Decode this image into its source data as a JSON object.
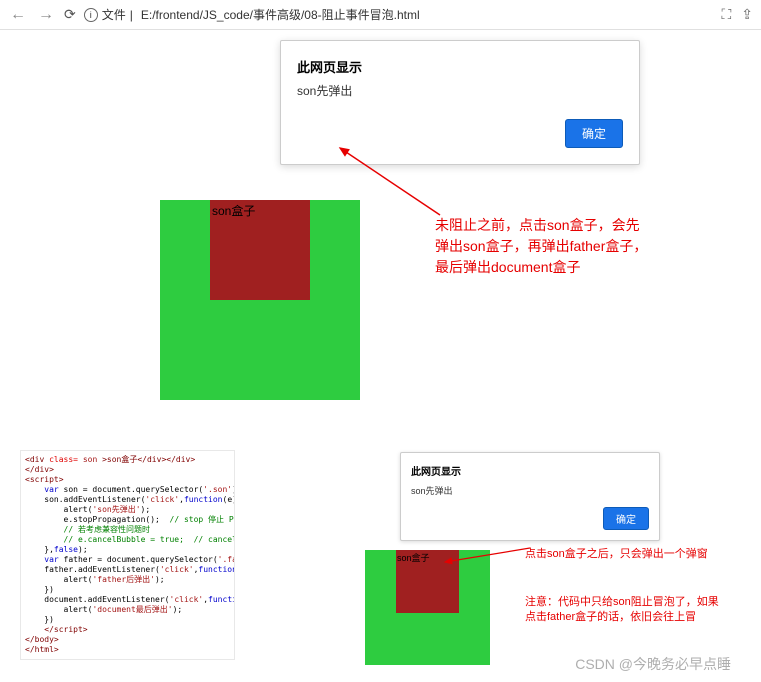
{
  "browser": {
    "file_label": "文件",
    "url": "E:/frontend/JS_code/事件高级/08-阻止事件冒泡.html"
  },
  "dialog": {
    "title": "此网页显示",
    "msg": "son先弹出",
    "ok": "确定"
  },
  "demo": {
    "son_label": "son盒子"
  },
  "notes": {
    "n1a": "未阻止之前，点击son盒子，会先",
    "n1b": "弹出son盒子，再弹出father盒子，",
    "n1c": "最后弹出document盒子",
    "n2": "点击son盒子之后，只会弹出一个弹窗",
    "n3a": "注意：代码中只给son阻止冒泡了，如果",
    "n3b": "点击father盒子的话，依旧会往上冒"
  },
  "code": {
    "l1a": "<div ",
    "l1b": "class=",
    "l1c": " son ",
    "l1d": ">son盒子</div></div>",
    "l2": "</div>",
    "l3": "<script>",
    "l4a": "    var",
    "l4b": " son = document.querySelector(",
    "l4c": "'.son'",
    "l4d": ");",
    "l5a": "    son.addEventListener(",
    "l5b": "'click'",
    "l5c": ",",
    "l5d": "function",
    "l5e": "(e) {",
    "l6a": "        alert(",
    "l6b": "'son先弹出'",
    "l6c": ");",
    "l7a": "        e.stopPropagation();  ",
    "l7b": "// stop 停止 Prop",
    "l8": "        // 若考虑兼容性问题时",
    "l9": "        // e.cancelBubble = true;  // cancel 取",
    "l10a": "    },",
    "l10b": "false",
    "l10c": ");",
    "l11a": "    var",
    "l11b": " father = document.querySelector(",
    "l11c": "'.fathe",
    "l12a": "    father.addEventListener(",
    "l12b": "'click'",
    "l12c": ",",
    "l12d": "function",
    "l12e": "()",
    "l13a": "        alert(",
    "l13b": "'father后弹出'",
    "l13c": ");",
    "l14": "    })",
    "l15a": "    document.addEventListener(",
    "l15b": "'click'",
    "l15c": ",",
    "l15d": "function",
    "l15e": "()",
    "l16a": "        alert(",
    "l16b": "'document最后弹出'",
    "l16c": ");",
    "l17": "    })",
    "l18": "    </script>",
    "l19": "</body>",
    "l20": "</html>"
  },
  "watermark": "CSDN @今晚务必早点睡"
}
